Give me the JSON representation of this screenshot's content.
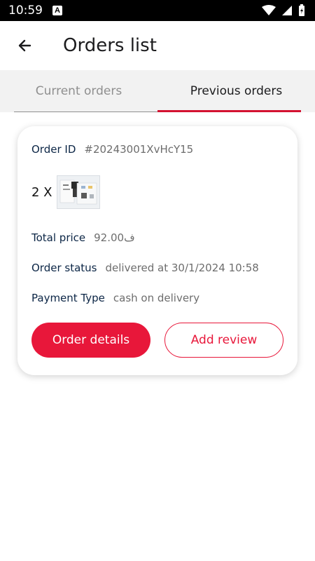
{
  "status_bar": {
    "time": "10:59",
    "notification_icon": "A"
  },
  "header": {
    "title": "Orders list",
    "back_icon": "arrow-left"
  },
  "tabs": [
    {
      "label": "Current orders",
      "selected": false
    },
    {
      "label": "Previous orders",
      "selected": true
    }
  ],
  "order": {
    "id_label": "Order ID",
    "id_value": "#20243001XvHcY15",
    "quantity": "2 X",
    "total_label": "Total price",
    "total_value": "92.00ف",
    "status_label": "Order status",
    "status_value": "delivered at 30/1/2024 10:58",
    "payment_label": "Payment Type",
    "payment_value": "cash on delivery",
    "details_button": "Order details",
    "review_button": "Add review"
  },
  "colors": {
    "accent": "#e8173a",
    "label": "#0b2545",
    "muted": "#6d6d6d",
    "tab_bg": "#f2f2f2"
  }
}
